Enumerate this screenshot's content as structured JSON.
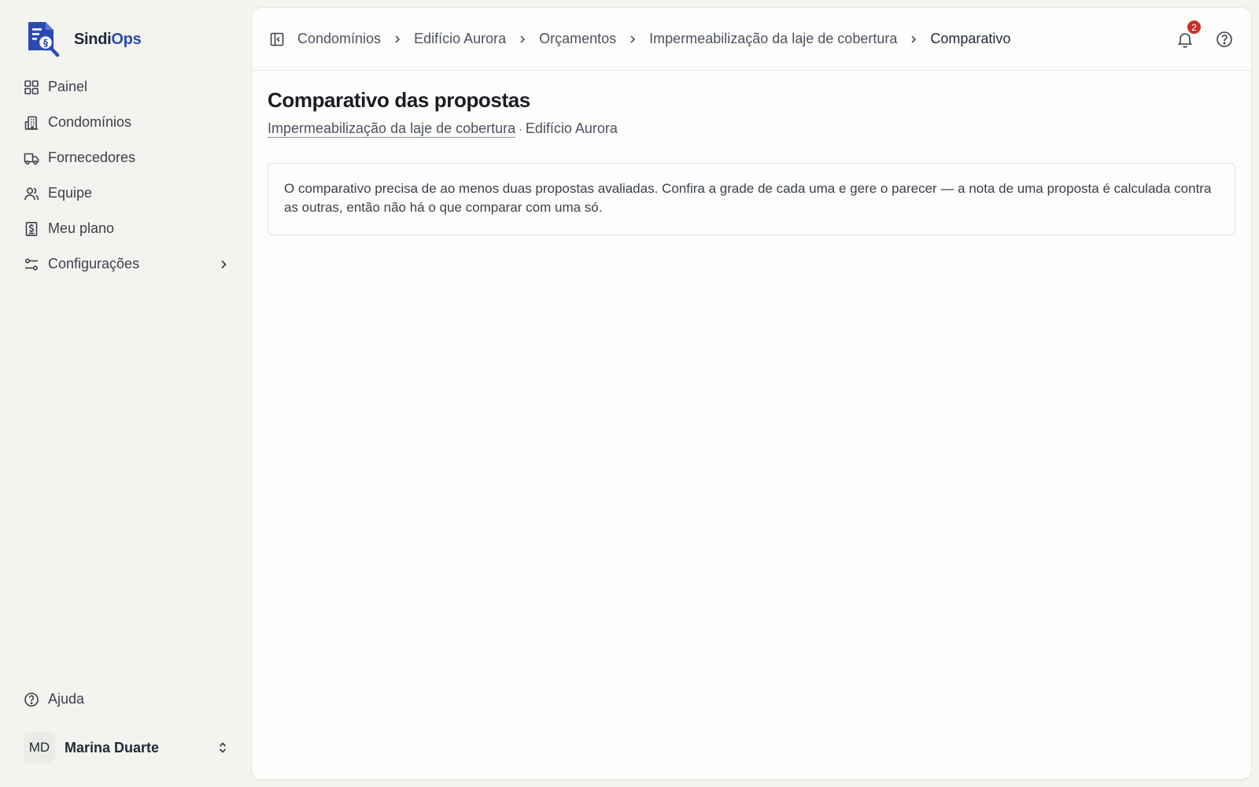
{
  "brand": {
    "name_prefix": "Sindi",
    "name_accent": "Ops"
  },
  "sidebar": {
    "items": [
      {
        "label": "Painel",
        "icon": "grid-icon"
      },
      {
        "label": "Condomínios",
        "icon": "building-icon"
      },
      {
        "label": "Fornecedores",
        "icon": "truck-icon"
      },
      {
        "label": "Equipe",
        "icon": "users-icon"
      },
      {
        "label": "Meu plano",
        "icon": "receipt-icon"
      },
      {
        "label": "Configurações",
        "icon": "settings-sliders-icon"
      }
    ],
    "help_label": "Ajuda"
  },
  "user": {
    "initials": "MD",
    "name": "Marina Duarte"
  },
  "breadcrumb": [
    "Condomínios",
    "Edifício Aurora",
    "Orçamentos",
    "Impermeabilização da laje de cobertura",
    "Comparativo"
  ],
  "notifications": {
    "count": "2"
  },
  "page": {
    "title": "Comparativo das propostas",
    "subtitle_link": "Impermeabilização da laje de cobertura",
    "subtitle_sep": "·",
    "subtitle_rest": "Edifício Aurora",
    "notice": "O comparativo precisa de ao menos duas propostas avaliadas. Confira a grade de cada uma e gere o parecer — a nota de uma proposta é calculada contra as outras, então não há o que comparar com uma só."
  },
  "colors": {
    "accent": "#2c4bb0",
    "badge": "#c2322b",
    "background": "#f3f3f0"
  }
}
